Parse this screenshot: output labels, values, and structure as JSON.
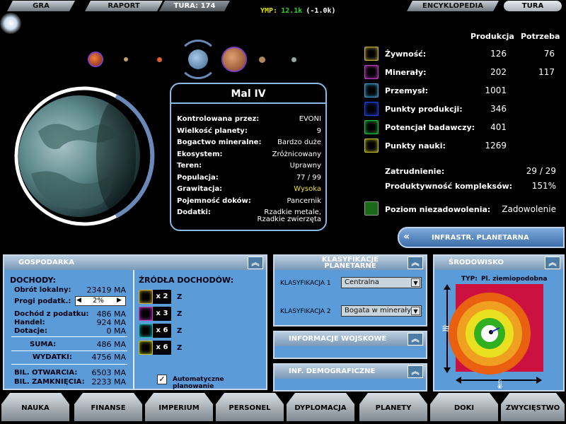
{
  "topbar": {
    "gra": "GRA",
    "raport": "RAPORT",
    "tura_label": "TURA: 174",
    "ymp_label": "YMP:",
    "ymp_value": "12.1k",
    "ymp_delta": "(-1.0k)",
    "encyklopedia": "ENCYKLOPEDIA",
    "tura_btn": "TURA"
  },
  "planet": {
    "name": "Mal IV",
    "rows": [
      {
        "k": "Kontrolowana przez:",
        "v": "EVONI"
      },
      {
        "k": "Wielkość planety:",
        "v": "9"
      },
      {
        "k": "Bogactwo mineralne:",
        "v": "Bardzo duże"
      },
      {
        "k": "Ekosystem:",
        "v": "Zróżnicowany"
      },
      {
        "k": "Teren:",
        "v": "Uprawny"
      },
      {
        "k": "Populacja:",
        "v": "77 / 99"
      },
      {
        "k": "Grawitacja:",
        "v": "Wysoka"
      },
      {
        "k": "Pojemność doków:",
        "v": "Pancernik"
      },
      {
        "k": "Dodatki:",
        "v": "Rzadkie metale,"
      }
    ],
    "dodatki_line2": "Rzadkie zwierzęta"
  },
  "stats": {
    "prod_hdr": "Produkcja",
    "potr_hdr": "Potrzeba",
    "rows": [
      {
        "label": "Żywność:",
        "prod": "126",
        "potr": "76",
        "icon": "food-icon",
        "color": "#c8b040"
      },
      {
        "label": "Minerały:",
        "prod": "202",
        "potr": "117",
        "icon": "minerals-icon",
        "color": "#c040c0"
      },
      {
        "label": "Przemysł:",
        "prod": "1001",
        "potr": "",
        "icon": "industry-icon",
        "color": "#3fa0d0"
      },
      {
        "label": "Punkty produkcji:",
        "prod": "346",
        "potr": "",
        "icon": "production-icon",
        "color": "#2040e0"
      },
      {
        "label": "Potencjał badawczy:",
        "prod": "401",
        "potr": "",
        "icon": "research-potential-icon",
        "color": "#20c040"
      },
      {
        "label": "Punkty nauki:",
        "prod": "1269",
        "potr": "",
        "icon": "science-icon",
        "color": "#c0c020"
      }
    ],
    "zatrudnienie_label": "Zatrudnienie:",
    "zatrudnienie": "29 / 29",
    "produktywnosc_label": "Produktywność kompleksów:",
    "produktywnosc": "151%",
    "niezad_label": "Poziom niezadowolenia:",
    "niezad": "Zadowolenie"
  },
  "infra_btn": "INFRASTR. PLANETARNA",
  "gospodarka": {
    "title": "GOSPODARKA",
    "dochody": "DOCHODY:",
    "obrot_label": "Obrót lokalny:",
    "obrot": "23419 MA",
    "progi_label": "Progi podatk.:",
    "progi": "2%",
    "dochod_label": "Dochód z podatku:",
    "dochod": "486 MA",
    "handel_label": "Handel:",
    "handel": "924 MA",
    "dotacje_label": "Dotacje:",
    "dotacje": "0 MA",
    "suma_label": "SUMA:",
    "suma": "486 MA",
    "wydatki_label": "WYDATKI:",
    "wydatki": "4756 MA",
    "bilo_label": "BIL. OTWARCIA:",
    "bilo": "6503 MA",
    "bilz_label": "BIL. ZAMKNIĘCIA:",
    "bilz": "2233 MA",
    "zrodla": "ŹRÓDŁA DOCHODÓW:",
    "sources": [
      {
        "mult": "x 2",
        "z": "Z"
      },
      {
        "mult": "x 3",
        "z": "Z"
      },
      {
        "mult": "x 6",
        "z": "Z"
      },
      {
        "mult": "x 6",
        "z": "Z"
      }
    ],
    "auto": "Automatyczne planowanie"
  },
  "klasyfikacje": {
    "title1": "KLASYFIKACJE",
    "title2": "PLANETARNE",
    "k1_label": "KLASYFIKACJA 1",
    "k1": "Centralna",
    "k2_label": "KLASYFIKACJA 2",
    "k2": "Bogata w minerały"
  },
  "wojskowe": "INFORMACJE WOJSKOWE",
  "demograficzne": "INF. DEMOGRAFICZNE",
  "srodowisko": {
    "title": "ŚRODOWISKO",
    "typ_label": "TYP:",
    "typ": "Pl. ziemiopodobna"
  },
  "nav": [
    "NAUKA",
    "FINANSE",
    "IMPERIUM",
    "PERSONEL",
    "DYPLOMACJA",
    "PLANETY",
    "DOKI",
    "ZWYCIĘSTWO"
  ]
}
